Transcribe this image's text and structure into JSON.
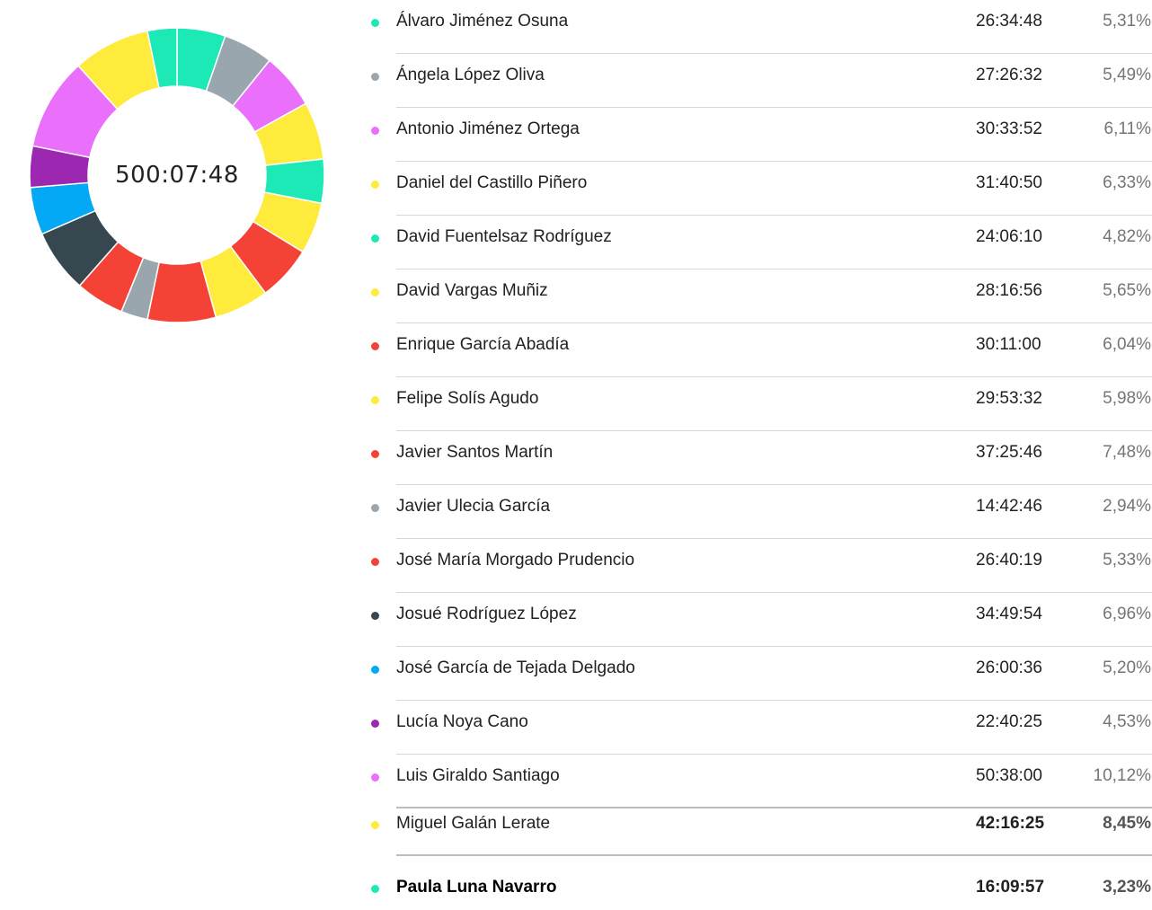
{
  "total_time": "500:07:48",
  "colors": {
    "teal": "#1de9b6",
    "gray": "#9aa6ad",
    "pink": "#ea6ffb",
    "yellow": "#ffeb3b",
    "red": "#f44336",
    "dark": "#37474f",
    "blue": "#03a9f4",
    "purple": "#9c27b0"
  },
  "chart_data": {
    "type": "pie",
    "center_label": "500:07:48",
    "slices": [
      {
        "name": "Álvaro Jiménez Osuna",
        "time": "26:34:48",
        "percent": 5.31,
        "percent_label": "5,31%",
        "color": "#1de9b6"
      },
      {
        "name": "Ángela López Oliva",
        "time": "27:26:32",
        "percent": 5.49,
        "percent_label": "5,49%",
        "color": "#9aa6ad"
      },
      {
        "name": "Antonio Jiménez Ortega",
        "time": "30:33:52",
        "percent": 6.11,
        "percent_label": "6,11%",
        "color": "#ea6ffb"
      },
      {
        "name": "Daniel del Castillo Piñero",
        "time": "31:40:50",
        "percent": 6.33,
        "percent_label": "6,33%",
        "color": "#ffeb3b"
      },
      {
        "name": "David Fuentelsaz Rodríguez",
        "time": "24:06:10",
        "percent": 4.82,
        "percent_label": "4,82%",
        "color": "#1de9b6"
      },
      {
        "name": "David Vargas Muñiz",
        "time": "28:16:56",
        "percent": 5.65,
        "percent_label": "5,65%",
        "color": "#ffeb3b"
      },
      {
        "name": "Enrique García Abadía",
        "time": "30:11:00",
        "percent": 6.04,
        "percent_label": "6,04%",
        "color": "#f44336"
      },
      {
        "name": "Felipe Solís Agudo",
        "time": "29:53:32",
        "percent": 5.98,
        "percent_label": "5,98%",
        "color": "#ffeb3b"
      },
      {
        "name": "Javier Santos Martín",
        "time": "37:25:46",
        "percent": 7.48,
        "percent_label": "7,48%",
        "color": "#f44336"
      },
      {
        "name": "Javier Ulecia García",
        "time": "14:42:46",
        "percent": 2.94,
        "percent_label": "2,94%",
        "color": "#9aa6ad"
      },
      {
        "name": "José María Morgado Prudencio",
        "time": "26:40:19",
        "percent": 5.33,
        "percent_label": "5,33%",
        "color": "#f44336"
      },
      {
        "name": "Josué Rodríguez López",
        "time": "34:49:54",
        "percent": 6.96,
        "percent_label": "6,96%",
        "color": "#37474f"
      },
      {
        "name": "José García de Tejada Delgado",
        "time": "26:00:36",
        "percent": 5.2,
        "percent_label": "5,20%",
        "color": "#03a9f4"
      },
      {
        "name": "Lucía Noya Cano",
        "time": "22:40:25",
        "percent": 4.53,
        "percent_label": "4,53%",
        "color": "#9c27b0"
      },
      {
        "name": "Luis Giraldo Santiago",
        "time": "50:38:00",
        "percent": 10.12,
        "percent_label": "10,12%",
        "color": "#ea6ffb"
      },
      {
        "name": "Miguel Galán Lerate",
        "time": "42:16:25",
        "percent": 8.45,
        "percent_label": "8,45%",
        "color": "#ffeb3b"
      },
      {
        "name": "Paula Luna Navarro",
        "time": "16:09:57",
        "percent": 3.23,
        "percent_label": "3,23%",
        "color": "#1de9b6"
      }
    ]
  }
}
